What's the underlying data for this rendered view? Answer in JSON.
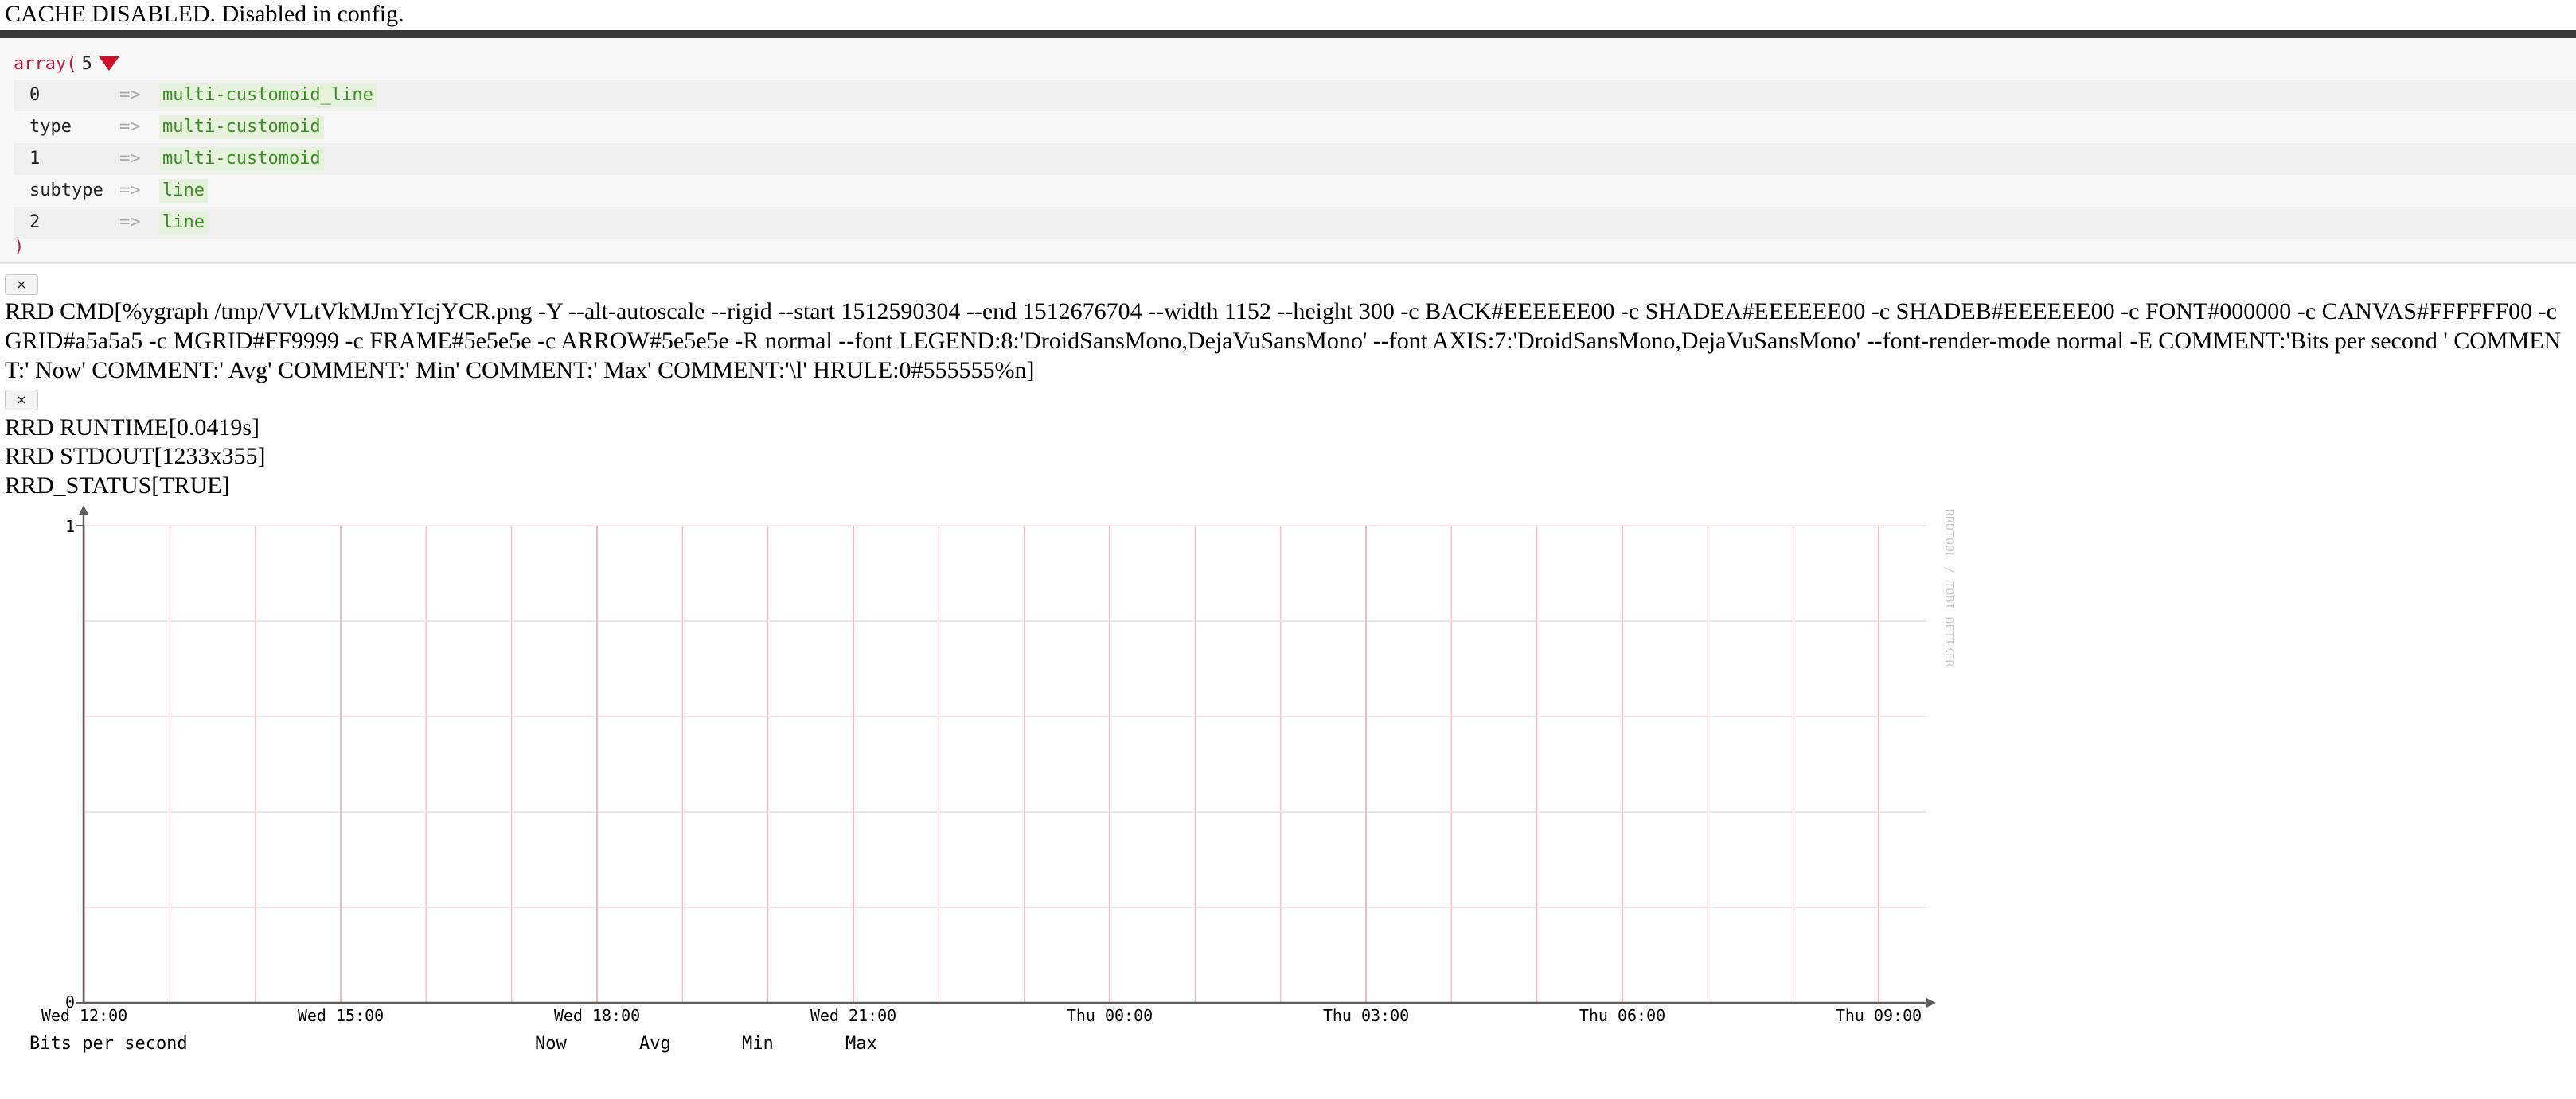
{
  "cache_notice": "CACHE DISABLED. Disabled in config.",
  "dump": {
    "open": "array(",
    "count": "5",
    "close": ")",
    "rows": [
      {
        "key": "0",
        "arrow": "=>",
        "value": "multi-customoid_line"
      },
      {
        "key": "type",
        "arrow": "=>",
        "value": "multi-customoid"
      },
      {
        "key": "1",
        "arrow": "=>",
        "value": "multi-customoid"
      },
      {
        "key": "subtype",
        "arrow": "=>",
        "value": "line"
      },
      {
        "key": "2",
        "arrow": "=>",
        "value": "line"
      }
    ]
  },
  "close_button_label": "×",
  "rrd_cmd": "RRD CMD[%ygraph /tmp/VVLtVkMJmYIcjYCR.png -Y --alt-autoscale --rigid --start 1512590304 --end 1512676704 --width 1152 --height 300 -c BACK#EEEEEE00 -c SHADEA#EEEEEE00 -c SHADEB#EEEEEE00 -c FONT#000000 -c CANVAS#FFFFFF00 -c GRID#a5a5a5 -c MGRID#FF9999 -c FRAME#5e5e5e -c ARROW#5e5e5e -R normal --font LEGEND:8:'DroidSansMono,DejaVuSansMono' --font AXIS:7:'DroidSansMono,DejaVuSansMono' --font-render-mode normal -E COMMENT:'Bits per second ' COMMENT:' Now' COMMENT:' Avg' COMMENT:' Min' COMMENT:' Max' COMMENT:'\\l' HRULE:0#555555%n]",
  "rrd_runtime": "RRD RUNTIME[0.0419s]",
  "rrd_stdout": "RRD STDOUT[1233x355]",
  "rrd_status": "RRD_STATUS[TRUE]",
  "chart_data": {
    "type": "line",
    "series": [],
    "x_ticks": [
      "Wed 12:00",
      "Wed 15:00",
      "Wed 18:00",
      "Wed 21:00",
      "Thu 00:00",
      "Thu 03:00",
      "Thu 06:00",
      "Thu 09:00"
    ],
    "y_ticks": [
      "0",
      "1"
    ],
    "ylim": [
      0,
      1
    ],
    "watermark": "RRDTOOL / TOBI OETIKER",
    "legend": [
      "Bits per second",
      "Now",
      "Avg",
      "Min",
      "Max"
    ],
    "grid": true,
    "colors": {
      "grid": "#a5a5a5",
      "major_grid": "#FF9999",
      "frame": "#5e5e5e",
      "arrow": "#5e5e5e",
      "hrule": "#555555"
    }
  }
}
